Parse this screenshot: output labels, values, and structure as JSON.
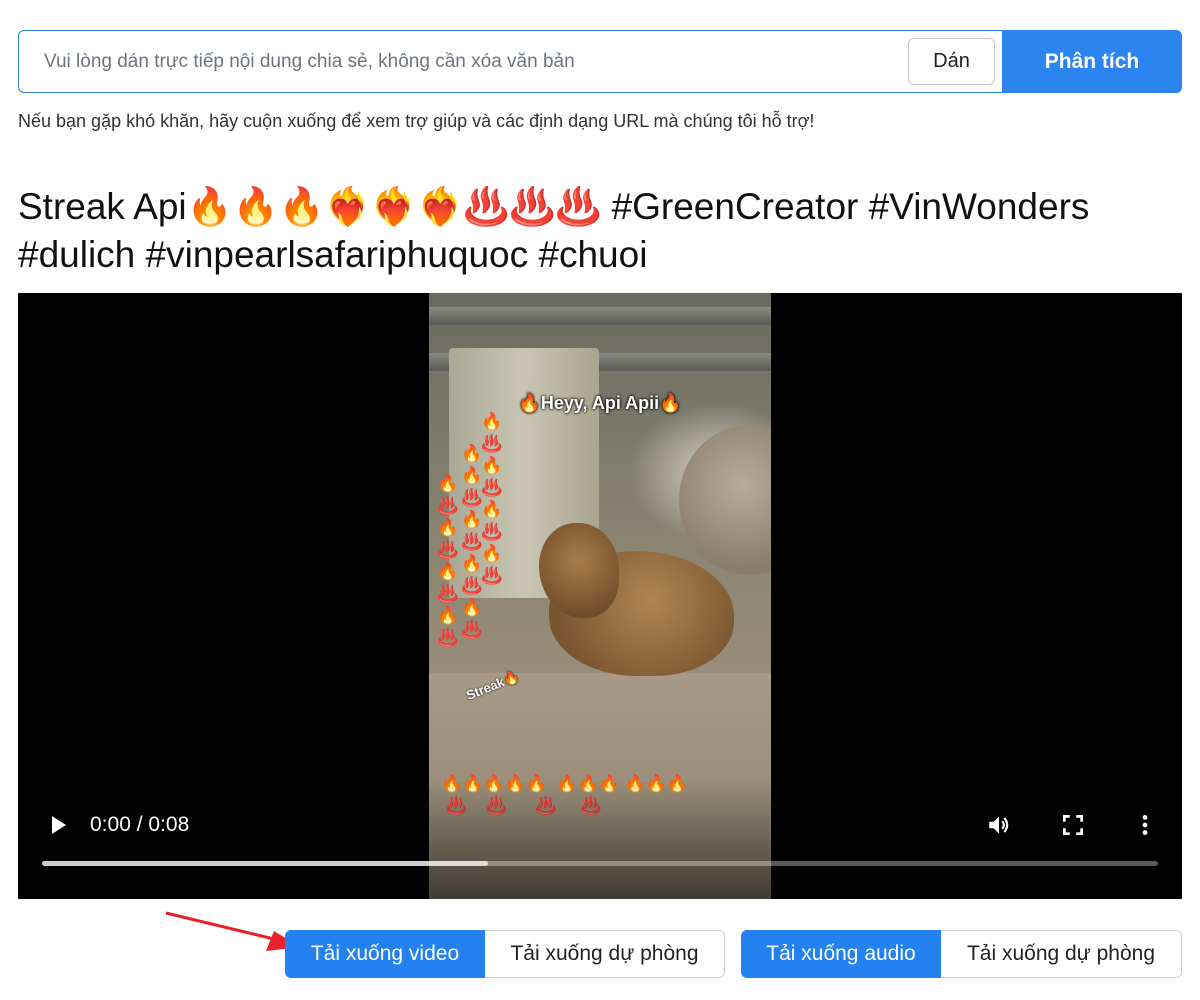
{
  "search": {
    "placeholder": "Vui lòng dán trực tiếp nội dung chia sẻ, không cần xóa văn bản",
    "value": "",
    "paste_label": "Dán",
    "analyze_label": "Phân tích"
  },
  "help_text": "Nếu bạn gặp khó khăn, hãy cuộn xuống để xem trợ giúp và các định dạng URL mà chúng tôi hỗ trợ!",
  "video": {
    "title": "Streak Api🔥🔥🔥❤️‍🔥❤️‍🔥❤️‍🔥♨️♨️♨️ #GreenCreator #VinWonders #dulich #vinpearlsafariphuquoc #chuoi",
    "overlay_text": "🔥Heyy, Api Apii🔥",
    "overlay_streak": "Streak🔥",
    "time": "0:00 / 0:08",
    "progress_buffered": 0.4,
    "icons": [
      "play-icon",
      "volume-icon",
      "fullscreen-icon",
      "more-options-icon"
    ]
  },
  "downloads": {
    "video_label": "Tải xuống video",
    "video_backup_label": "Tải xuống dự phòng",
    "audio_label": "Tải xuống audio",
    "audio_backup_label": "Tải xuống dự phòng"
  },
  "colors": {
    "primary": "#2382f0",
    "annotation_arrow": "#e8202a"
  }
}
